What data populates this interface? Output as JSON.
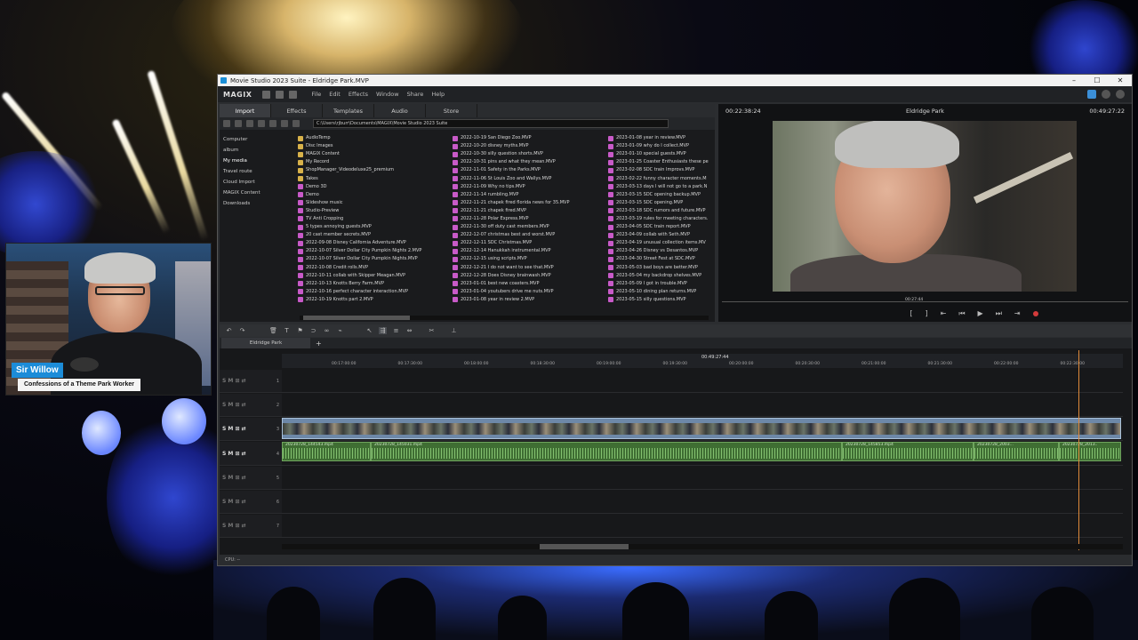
{
  "window": {
    "title": "Movie Studio 2023 Suite - Eldridge Park.MVP",
    "controls": [
      "–",
      "☐",
      "✕"
    ]
  },
  "menubar": {
    "logo": "MAGIX",
    "items": [
      "File",
      "Edit",
      "Effects",
      "Window",
      "Share",
      "Help"
    ]
  },
  "pool": {
    "tabs": [
      "Import",
      "Effects",
      "Templates",
      "Audio",
      "Store"
    ],
    "path": "C:\\Users\\rjburr\\Documents\\MAGIX\\Movie Studio 2023 Suite",
    "folders": [
      "Computer",
      "album",
      "My media",
      "Travel route",
      "Cloud Import",
      "MAGIX Content",
      "Downloads"
    ],
    "col1": [
      {
        "t": "folder",
        "n": "AudioTemp"
      },
      {
        "t": "folder",
        "n": "Disc Images"
      },
      {
        "t": "folder",
        "n": "MAGIX Content"
      },
      {
        "t": "folder",
        "n": "My Record"
      },
      {
        "t": "folder",
        "n": "ShopManager_Videodeluxe25_premium"
      },
      {
        "t": "folder",
        "n": "Takes"
      },
      {
        "t": "mvp",
        "n": "Demo 3D"
      },
      {
        "t": "mvp",
        "n": "Demo"
      },
      {
        "t": "mvp",
        "n": "Slideshow music"
      },
      {
        "t": "mvp",
        "n": "Studio-Preview"
      },
      {
        "t": "mvp",
        "n": "TV Anti Cropping"
      },
      {
        "t": "mvp",
        "n": "5 types annoying guests.MVP"
      },
      {
        "t": "mvp",
        "n": "20 cast member secrets.MVP"
      },
      {
        "t": "mvp",
        "n": "2022-09-08 Disney California Adventure.MVP"
      },
      {
        "t": "mvp",
        "n": "2022-10-07 Silver Dollar City Pumpkin Nights 2.MVP"
      },
      {
        "t": "mvp",
        "n": "2022-10-07 Silver Dollar City Pumpkin Nights.MVP"
      },
      {
        "t": "mvp",
        "n": "2022-10-08 Credit rolls.MVP"
      },
      {
        "t": "mvp",
        "n": "2022-10-11 collab with Skipper Meagan.MVP"
      },
      {
        "t": "mvp",
        "n": "2022-10-13 Knotts Berry Farm.MVP"
      },
      {
        "t": "mvp",
        "n": "2022-10-16 perfect character interaction.MVP"
      },
      {
        "t": "mvp",
        "n": "2022-10-19 Knotts part 2.MVP"
      }
    ],
    "col2": [
      "2022-10-19 San Diego Zoo.MVP",
      "2022-10-20 disney myths.MVP",
      "2022-10-30 silly question shorts.MVP",
      "2022-10-31 pins and what they mean.MVP",
      "2022-11-01 Safety in the Parks.MVP",
      "2022-11-06 St Louis Zoo and Wallys.MVP",
      "2022-11-09 Why no tips.MVP",
      "2022-11-14 rumbling.MVP",
      "2022-11-21 chapek fired florida news for 35.MVP",
      "2022-11-21 chapek fired.MVP",
      "2022-11-28 Polar Express.MVP",
      "2022-11-30 off duty cast members.MVP",
      "2022-12-07 christmas best and worst.MVP",
      "2022-12-11 SDC Christmas.MVP",
      "2022-12-14 Hanukkah instrumental.MVP",
      "2022-12-15 using scripts.MVP",
      "2022-12-21 I do not want to see that.MVP",
      "2022-12-28 Does Disney brainwash.MVP",
      "2023-01-01 best new coasters.MVP",
      "2023-01-04 youtubers drive me nuts.MVP",
      "2023-01-08 year in review 2.MVP"
    ],
    "col3": [
      "2023-01-08 year in review.MVP",
      "2023-01-09 why do I collect.MVP",
      "2023-01-10 special guests.MVP",
      "2023-01-25 Coaster Enthusiasts these pe",
      "2023-02-08 SDC train Improvs.MVP",
      "2023-02-22 funny character moments.M",
      "2023-03-13 days I will not go to a park.N",
      "2023-03-15 SDC opening backup.MVP",
      "2023-03-15 SDC opening.MVP",
      "2023-03-18 SDC rumors and future.MVP",
      "2023-03-19 rules for meeting characters.",
      "2023-04-05 SDC train report.MVP",
      "2023-04-09 collab with Seth.MVP",
      "2023-04-19 unusual collection items.MV",
      "2023-04-26 Disney vs Desantos.MVP",
      "2023-04-30 Street Fest at SDC.MVP",
      "2023-05-03 bad boys are better.MVP",
      "2023-05-04 my backdrop shelves.MVP",
      "2023-05-09 I got in trouble.MVP",
      "2023-05-10 dining plan returns.MVP",
      "2023-05-15 silly questions.MVP"
    ]
  },
  "preview": {
    "timecode_left": "00:22:38:24",
    "title": "Eldridge Park",
    "timecode_right": "00:49:27:22",
    "marker": "00:27:44"
  },
  "timeline": {
    "tab": "Eldridge Park",
    "position": "00:49:27:44",
    "ruler": [
      "00:17:00:00",
      "00:17:30:00",
      "00:18:00:00",
      "00:18:30:00",
      "00:19:00:00",
      "00:19:30:00",
      "00:20:00:00",
      "00:20:30:00",
      "00:21:00:00",
      "00:21:30:00",
      "00:22:00:00",
      "00:22:30:00"
    ],
    "audio_clips": [
      "20230728_144543.mp4",
      "20230728_145031.mp4",
      "20230728_145853.mp4",
      "20230728_2003...",
      "20230728_2013.."
    ],
    "tracks": [
      "1",
      "2",
      "3",
      "4",
      "5",
      "6",
      "7"
    ]
  },
  "status": {
    "cpu": "CPU: --"
  },
  "overlay": {
    "name": "Sir Willow",
    "subtitle": "Confessions of a Theme Park Worker"
  }
}
